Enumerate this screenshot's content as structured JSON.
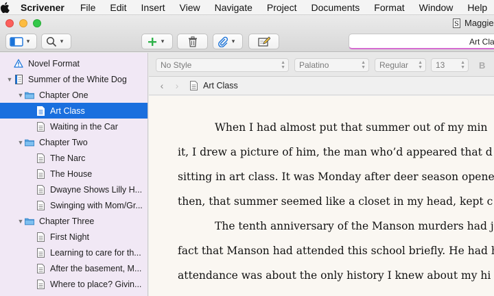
{
  "menubar": {
    "app": "Scrivener",
    "items": [
      "File",
      "Edit",
      "Insert",
      "View",
      "Navigate",
      "Project",
      "Documents",
      "Format",
      "Window",
      "Help"
    ]
  },
  "window": {
    "title": "Maggie"
  },
  "toolbar": {
    "title_field": "Art Cla"
  },
  "binder": {
    "items": [
      {
        "label": "Novel Format",
        "icon": "warning-icon",
        "level": 0
      },
      {
        "label": "Summer of the White Dog",
        "icon": "manuscript-icon",
        "level": 0,
        "expanded": true
      },
      {
        "label": "Chapter One",
        "icon": "folder-icon",
        "level": 1,
        "expanded": true
      },
      {
        "label": "Art Class",
        "icon": "document-icon",
        "level": 2,
        "selected": true
      },
      {
        "label": "Waiting in the Car",
        "icon": "document-icon",
        "level": 2
      },
      {
        "label": "Chapter Two",
        "icon": "folder-icon",
        "level": 1,
        "expanded": true
      },
      {
        "label": "The Narc",
        "icon": "document-icon",
        "level": 2
      },
      {
        "label": "The House",
        "icon": "document-icon",
        "level": 2
      },
      {
        "label": "Dwayne Shows Lilly H...",
        "icon": "document-icon",
        "level": 2
      },
      {
        "label": "Swinging with Mom/Gr...",
        "icon": "document-icon",
        "level": 2
      },
      {
        "label": "Chapter Three",
        "icon": "folder-icon",
        "level": 1,
        "expanded": true
      },
      {
        "label": "First Night",
        "icon": "document-icon",
        "level": 2
      },
      {
        "label": "Learning to care for th...",
        "icon": "document-icon",
        "level": 2
      },
      {
        "label": "After the basement, M...",
        "icon": "document-icon",
        "level": 2
      },
      {
        "label": "Where to place? Givin...",
        "icon": "document-icon",
        "level": 2
      }
    ]
  },
  "formatbar": {
    "style": "No Style",
    "font": "Palatino",
    "weight": "Regular",
    "size": "13",
    "bold": "B"
  },
  "header": {
    "document": "Art Class"
  },
  "editor": {
    "paragraphs": [
      [
        "When I had almost put that summer out of my min",
        "it, I drew a picture of him, the man who’d appeared that d",
        "sitting in art class. It was Monday after deer season opene",
        "then, that summer seemed like a closet in my head, kept c"
      ],
      [
        "The tenth anniversary of the Manson murders had j",
        "fact that Manson had attended this school briefly. He had h",
        "attendance was about the only history I knew about my hi"
      ]
    ]
  },
  "colors": {
    "binder_bg": "#f1e8f5",
    "selection": "#1a6fde",
    "editor_bg": "#faf7f2",
    "folder": "#5aa9e6",
    "add_green": "#2fb24a"
  }
}
